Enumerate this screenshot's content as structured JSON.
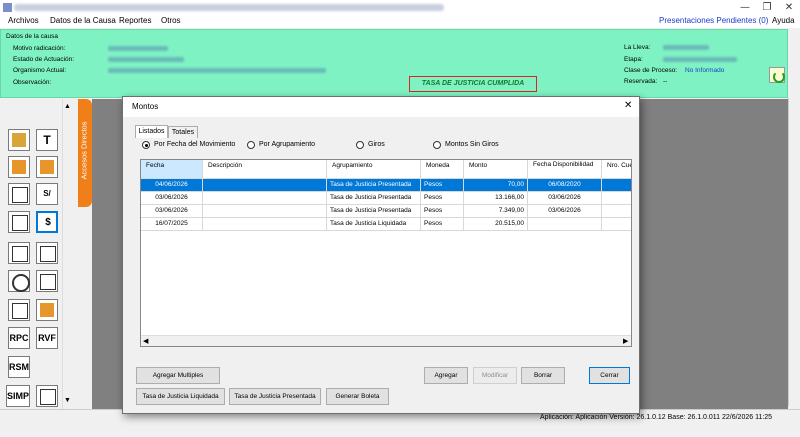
{
  "window": {
    "minimize": "—",
    "maximize": "❐",
    "close": "✕"
  },
  "menu": {
    "items": [
      "Archivos",
      "Datos de la Causa",
      "Reportes",
      "Otros"
    ],
    "presentaciones": "Presentaciones Pendientes (0)",
    "ayuda": "Ayuda"
  },
  "header": {
    "section_title": "Datos de la causa",
    "motivo_label": "Motivo radicación:",
    "estado_label": "Estado de Actuación:",
    "organismo_label": "Organismo Actual:",
    "observacion_label": "Observación:",
    "tasa_banner": "TASA DE JUSTICIA CUMPLIDA",
    "lleva_label": "La Lleva:",
    "etapa_label": "Etapa:",
    "clase_label": "Clase de Proceso:",
    "clase_value": "No Informado",
    "reservada_label": "Reservada:",
    "reservada_value": "--"
  },
  "sidebar": {
    "accesos_label": "Accesos Directos",
    "text_tools": [
      "RPC",
      "RVF",
      "RSM",
      "SIMP"
    ],
    "scroll_up": "▲",
    "scroll_down": "▼"
  },
  "dialog": {
    "title": "Montos",
    "close": "✕",
    "tabs": [
      "Listados",
      "Totales"
    ],
    "radios": [
      {
        "label": "Por Fecha del Movimiento",
        "checked": true
      },
      {
        "label": "Por Agrupamiento",
        "checked": false
      },
      {
        "label": "Giros",
        "checked": false
      },
      {
        "label": "Montos Sin Giros",
        "checked": false
      }
    ],
    "columns": [
      "Fecha",
      "Descripción",
      "Agrupamiento",
      "Moneda",
      "Monto",
      "Fecha Disponibilidad",
      "Nro. Cue"
    ],
    "rows": [
      {
        "fecha": "04/06/2026",
        "descripcion": "",
        "agrupamiento": "Tasa de Justicia Presentada",
        "moneda": "Pesos",
        "monto": "70,00",
        "disponibilidad": "06/08/2020",
        "cuenta": "",
        "selected": true
      },
      {
        "fecha": "03/06/2026",
        "descripcion": "",
        "agrupamiento": "Tasa de Justicia Presentada",
        "moneda": "Pesos",
        "monto": "13.166,00",
        "disponibilidad": "03/06/2026",
        "cuenta": "",
        "selected": false
      },
      {
        "fecha": "03/06/2026",
        "descripcion": "",
        "agrupamiento": "Tasa de Justicia Presentada",
        "moneda": "Pesos",
        "monto": "7.349,00",
        "disponibilidad": "03/06/2026",
        "cuenta": "",
        "selected": false
      },
      {
        "fecha": "16/07/2025",
        "descripcion": "",
        "agrupamiento": "Tasa de Justicia Liquidada",
        "moneda": "Pesos",
        "monto": "20.515,00",
        "disponibilidad": "",
        "cuenta": "",
        "selected": false
      }
    ],
    "scroll_left": "◀",
    "scroll_right": "▶",
    "buttons": {
      "agregar_multiples": "Agregar Multiples",
      "tasa_liquidada": "Tasa de Justicia Liquidada",
      "tasa_presentada": "Tasa de Justicia Presentada",
      "generar_boleta": "Generar Boleta",
      "agregar": "Agregar",
      "modificar": "Modificar",
      "borrar": "Borrar",
      "cerrar": "Cerrar"
    }
  },
  "status": {
    "text": "Aplicación: Aplicación Versión: 26.1.0.12  Base: 26.1.0.011  22/6/2026  11:25"
  },
  "colors": {
    "header_green": "#7ef2c3",
    "banner_border": "#dd2222",
    "selection_blue": "#0078d7",
    "accesos_orange": "#f07f1a"
  }
}
